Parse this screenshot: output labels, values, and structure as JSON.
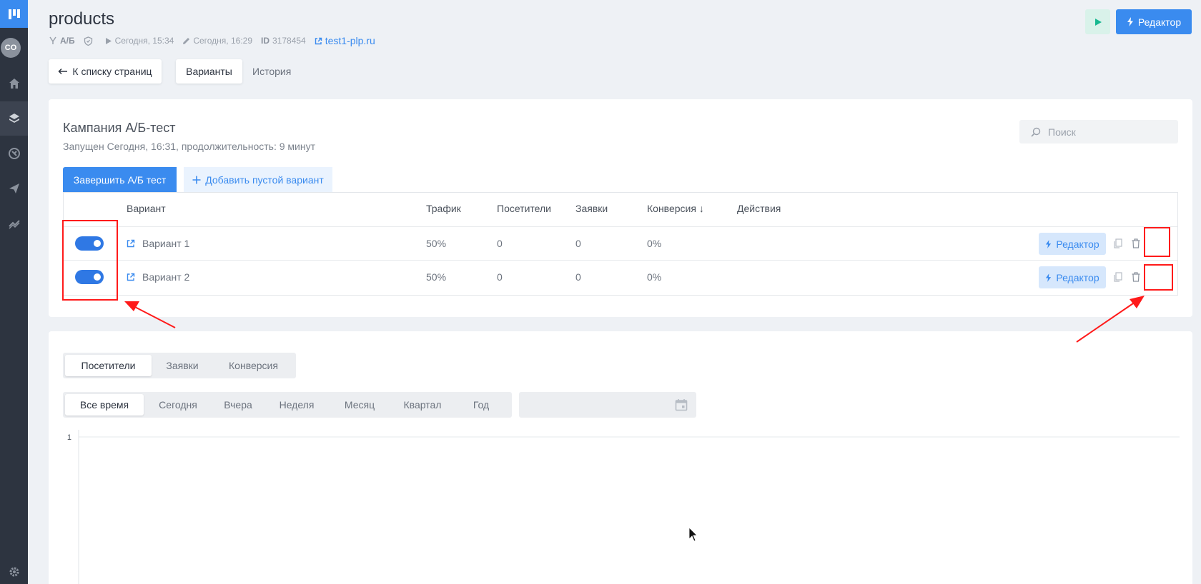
{
  "sidebar": {
    "avatar": "CO",
    "items": [
      "home-icon",
      "layers-icon",
      "integrations-icon",
      "send-icon",
      "analytics-icon"
    ],
    "settings": "gear-icon"
  },
  "header": {
    "title": "products",
    "meta": {
      "ab": "А/Б",
      "published": "Сегодня, 15:34",
      "edited": "Сегодня, 16:29",
      "id_label": "ID",
      "id_value": "3178454",
      "domain": "test1-plp.ru"
    },
    "editor_button": "Редактор"
  },
  "nav": {
    "back": "К списку страниц",
    "tabs": [
      "Варианты",
      "История"
    ]
  },
  "campaign": {
    "title": "Кампания А/Б-тест",
    "subtitle": "Запущен Сегодня, 16:31, продолжительность: 9 минут",
    "search_placeholder": "Поиск",
    "finish_button": "Завершить А/Б тест",
    "add_button": "Добавить пустой вариант"
  },
  "table": {
    "columns": [
      "Вариант",
      "Трафик",
      "Посетители",
      "Заявки",
      "Конверсия ↓",
      "Действия"
    ],
    "rows": [
      {
        "enabled": true,
        "name": "Вариант 1",
        "traffic": "50%",
        "visitors": "0",
        "leads": "0",
        "conversion": "0%",
        "editor": "Редактор"
      },
      {
        "enabled": true,
        "name": "Вариант 2",
        "traffic": "50%",
        "visitors": "0",
        "leads": "0",
        "conversion": "0%",
        "editor": "Редактор"
      }
    ]
  },
  "stats": {
    "metric_tabs": [
      "Посетители",
      "Заявки",
      "Конверсия"
    ],
    "period_tabs": [
      "Все время",
      "Сегодня",
      "Вчера",
      "Неделя",
      "Месяц",
      "Квартал",
      "Год"
    ]
  },
  "chart_data": {
    "type": "line",
    "series": [],
    "y_tick_labels": [
      "1"
    ],
    "ylim": [
      0,
      1
    ]
  },
  "colors": {
    "accent": "#3a8bef",
    "sidebar": "#2d3440",
    "annotation": "#ff1a1a"
  }
}
